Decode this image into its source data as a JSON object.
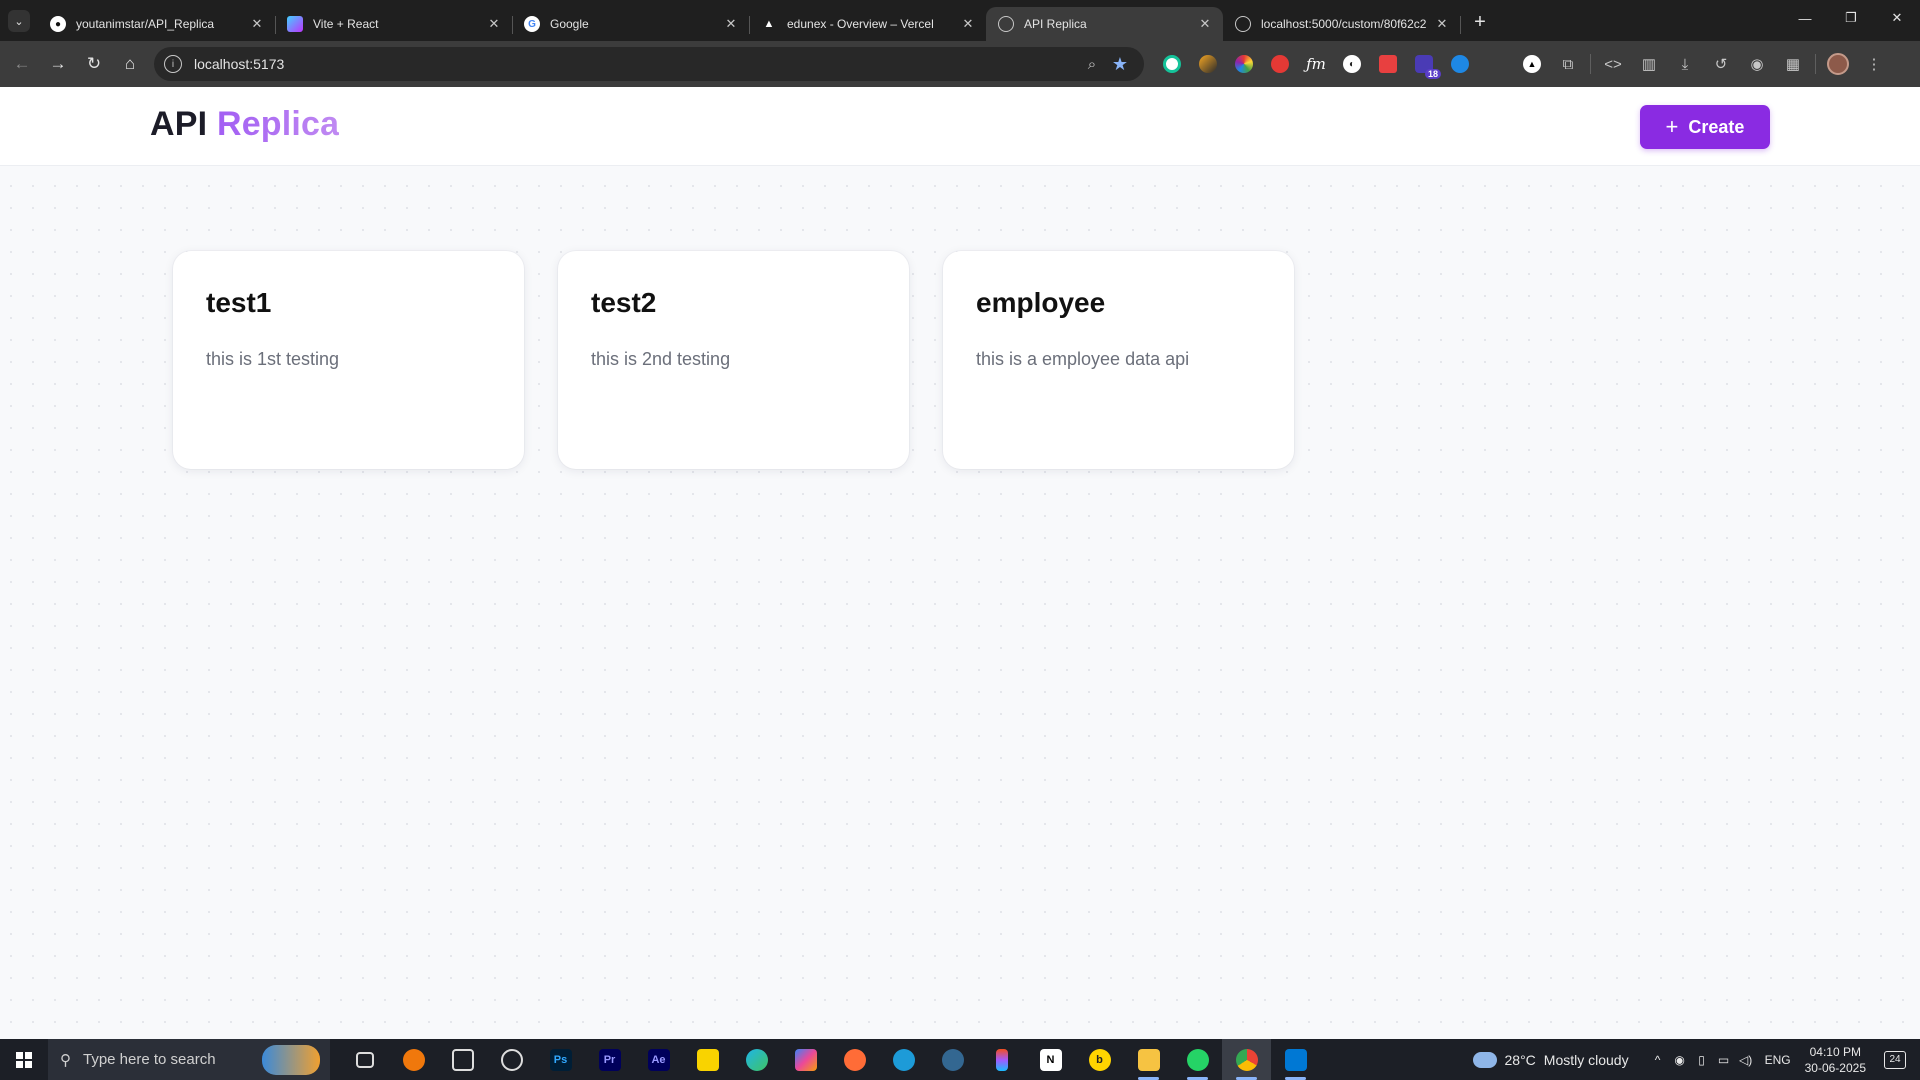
{
  "browser": {
    "tabs": [
      {
        "title": "youtanimstar/API_Replica",
        "favicon": "github-icon",
        "color": "#ffffff",
        "active": false
      },
      {
        "title": "Vite + React",
        "favicon": "vite-icon",
        "color": "#a45cff",
        "active": false
      },
      {
        "title": "Google",
        "favicon": "google-icon",
        "color": "#4285f4",
        "active": false
      },
      {
        "title": "edunex - Overview – Vercel",
        "favicon": "vercel-icon",
        "color": "#ffffff",
        "active": false
      },
      {
        "title": "API Replica",
        "favicon": "globe-icon",
        "color": "#c7c7c7",
        "active": true
      },
      {
        "title": "localhost:5000/custom/80f62c2",
        "favicon": "globe-icon",
        "color": "#c7c7c7",
        "active": false
      }
    ],
    "address": "localhost:5173",
    "extension_badge": "18"
  },
  "app": {
    "brand_part1": "API",
    "brand_part2": "Replica",
    "create_label": "Create",
    "accent": "#8a2be2"
  },
  "cards": [
    {
      "title": "test1",
      "description": "this is 1st testing"
    },
    {
      "title": "test2",
      "description": "this is 2nd testing"
    },
    {
      "title": "employee",
      "description": "this is a employee data api"
    }
  ],
  "taskbar": {
    "search_placeholder": "Type here to search",
    "weather_temp": "28°C",
    "weather_desc": "Mostly cloudy",
    "language": "ENG",
    "time": "04:10 PM",
    "date": "30-06-2025",
    "notification_count": "24"
  }
}
